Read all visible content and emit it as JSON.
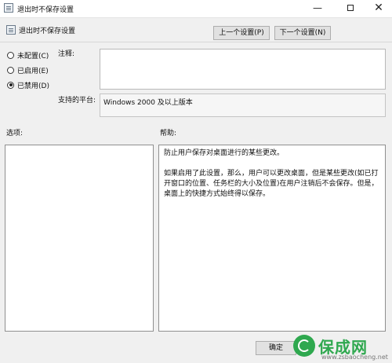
{
  "window": {
    "title": "退出时不保存设置",
    "controls": {
      "minimize": "—",
      "close": "✕"
    }
  },
  "header": {
    "setting_name": "退出时不保存设置",
    "prev_button": "上一个设置(P)",
    "next_button": "下一个设置(N)"
  },
  "state": {
    "options": [
      {
        "label": "未配置(C)",
        "selected": false
      },
      {
        "label": "已启用(E)",
        "selected": false
      },
      {
        "label": "已禁用(D)",
        "selected": true
      }
    ]
  },
  "fields": {
    "notes_label": "注释:",
    "notes_value": "",
    "platform_label": "支持的平台:",
    "platform_value": "Windows 2000 及以上版本"
  },
  "panels": {
    "options_label": "选项:",
    "help_label": "帮助:",
    "help_paragraph_1": "防止用户保存对桌面进行的某些更改。",
    "help_paragraph_2": "如果启用了此设置，那么，用户可以更改桌面，但是某些更改(如已打开窗口的位置、任务栏的大小及位置)在用户注销后不会保存。但是，桌面上的快捷方式始终得以保存。"
  },
  "footer": {
    "ok_button": "确定"
  },
  "watermark": {
    "brand": "保成网",
    "url": "www.zsbaocheng.net"
  }
}
